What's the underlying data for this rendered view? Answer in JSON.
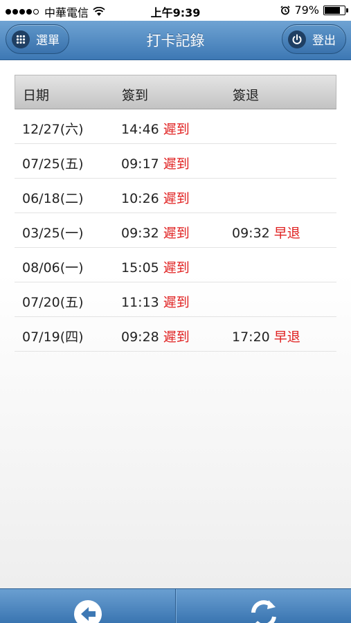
{
  "status_bar": {
    "carrier": "中華電信",
    "time": "上午9:39",
    "battery": "79%",
    "battery_level": 0.79
  },
  "nav": {
    "title": "打卡記錄",
    "menu_label": "選單",
    "logout_label": "登出"
  },
  "table": {
    "headers": [
      "日期",
      "簽到",
      "簽退"
    ],
    "rows": [
      {
        "date": "12/27(六)",
        "in_time": "14:46",
        "in_flag": "遲到",
        "out_time": "",
        "out_flag": ""
      },
      {
        "date": "07/25(五)",
        "in_time": "09:17",
        "in_flag": "遲到",
        "out_time": "",
        "out_flag": ""
      },
      {
        "date": "06/18(二)",
        "in_time": "10:26",
        "in_flag": "遲到",
        "out_time": "",
        "out_flag": ""
      },
      {
        "date": "03/25(一)",
        "in_time": "09:32",
        "in_flag": "遲到",
        "out_time": "09:32",
        "out_flag": "早退"
      },
      {
        "date": "08/06(一)",
        "in_time": "15:05",
        "in_flag": "遲到",
        "out_time": "",
        "out_flag": ""
      },
      {
        "date": "07/20(五)",
        "in_time": "11:13",
        "in_flag": "遲到",
        "out_time": "",
        "out_flag": ""
      },
      {
        "date": "07/19(四)",
        "in_time": "09:28",
        "in_flag": "遲到",
        "out_time": "17:20",
        "out_flag": "早退"
      }
    ]
  },
  "toolbar": {
    "back_icon": "back-arrow-icon",
    "refresh_icon": "refresh-icon"
  },
  "colors": {
    "nav_blue": "#3d78b4",
    "flag_red": "#e02020"
  }
}
